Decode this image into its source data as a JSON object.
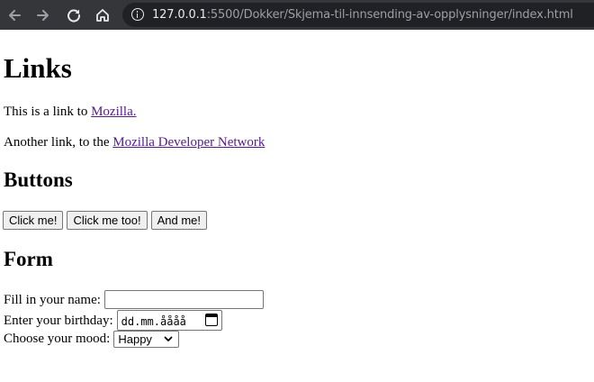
{
  "browser": {
    "url_host": "127.0.0.1",
    "url_path": ":5500/Dokker/Skjema-til-innsending-av-opplysninger/index.html"
  },
  "page": {
    "links_heading": "Links",
    "link_line_1": {
      "prefix": "This is a link to ",
      "link_text": "Mozilla."
    },
    "link_line_2": {
      "prefix": "Another link, to the ",
      "link_text": "Mozilla Developer Network"
    },
    "buttons_heading": "Buttons",
    "buttons": [
      "Click me!",
      "Click me too!",
      "And me!"
    ],
    "form_heading": "Form",
    "form": {
      "name_label": "Fill in your name:",
      "name_value": "",
      "birthday_label": "Enter your birthday:",
      "birthday_placeholder": "dd.mm.åååå",
      "mood_label": "Choose your mood:",
      "mood_value": "Happy"
    }
  },
  "colors": {
    "chrome_bg": "#35363a",
    "omnibox_bg": "#202124",
    "visited_link": "#551a8b"
  }
}
